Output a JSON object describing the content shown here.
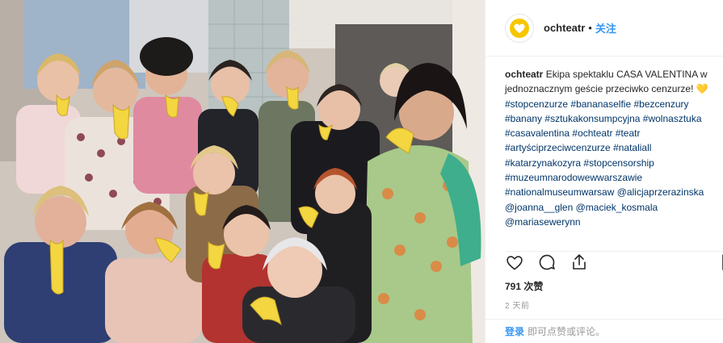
{
  "header": {
    "username": "ochteatr",
    "separator": "•",
    "follow_label": "关注",
    "avatar_icon": "heart-logo-icon",
    "avatar_color": "#f7c600"
  },
  "caption": {
    "username": "ochteatr",
    "text": "Ekipa spektaklu CASA VALENTINA w jednoznacznym geście przeciwko cenzurze!",
    "emoji": "💛",
    "tags": [
      "#stopcenzurze",
      "#bananaselfie",
      "#bezcenzury",
      "#banany",
      "#sztukakonsumpcyjna",
      "#wolnasztuka",
      "#casavalentina",
      "#ochteatr",
      "#teatr",
      "#artyściprzeciwcenzurze",
      "#nataliall",
      "#katarzynakozyra",
      "#stopcensorship",
      "#muzeumnarodowewwarszawie",
      "#nationalmuseumwarsaw"
    ],
    "mentions": [
      "@alicjaprzerazinska",
      "@joanna__glen",
      "@maciek_kosmala",
      "@mariasewerynn"
    ]
  },
  "actions": {
    "like_icon": "heart-outline-icon",
    "comment_icon": "comment-icon",
    "share_icon": "share-icon",
    "save_icon": "bookmark-icon"
  },
  "likes": {
    "text": "791 次赞"
  },
  "time": {
    "text": "2 天前"
  },
  "comment_bar": {
    "login_label": "登录",
    "tail_text": "即可点赞或评论。"
  },
  "photo": {
    "background": "#d9d2cb",
    "banana_color": "#f3d640"
  }
}
